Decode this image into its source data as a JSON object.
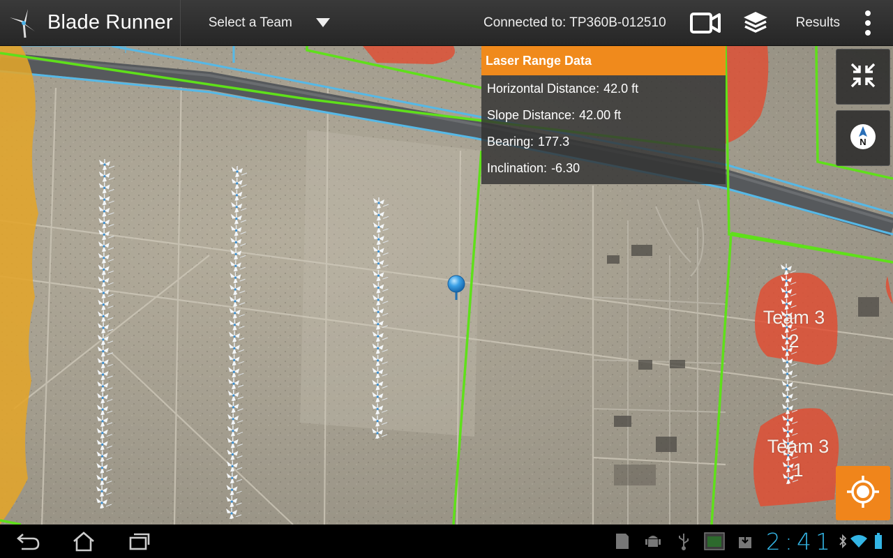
{
  "app": {
    "title": "Blade Runner",
    "team_select_label": "Select a Team",
    "connection_text": "Connected to: TP360B-012510",
    "results_label": "Results"
  },
  "icons": {
    "app": "wind-turbine-icon",
    "team_dropdown": "caret-down-icon",
    "camera": "video-camera-icon",
    "layers": "layers-icon",
    "overflow": "overflow-menu-icon",
    "collapse": "collapse-arrows-icon",
    "compass": "compass-north-icon",
    "locate": "crosshair-locate-icon",
    "marker": "map-pin-icon",
    "back": "back-icon",
    "home": "home-icon",
    "recents": "recent-apps-icon",
    "sd_card": "sd-card-icon",
    "android": "android-debug-icon",
    "usb": "usb-icon",
    "screenshot": "screenshot-icon",
    "download": "download-icon",
    "bluetooth": "bluetooth-icon",
    "wifi": "wifi-icon",
    "battery": "battery-icon"
  },
  "laser_range": {
    "title": "Laser Range Data",
    "rows": [
      {
        "label": "Horizontal Distance:",
        "value": "42.0 ft"
      },
      {
        "label": "Slope Distance:",
        "value": "42.00 ft"
      },
      {
        "label": "Bearing:",
        "value": "177.3"
      },
      {
        "label": "Inclination:",
        "value": "-6.30"
      }
    ]
  },
  "map": {
    "zones": [
      {
        "line1": "Team 3",
        "line2": "2"
      },
      {
        "line1": "Team 3",
        "line2": "1"
      }
    ]
  },
  "system": {
    "clock": "2:41"
  },
  "colors": {
    "accent": "#f08a1c",
    "boundary": "#5fe01a",
    "zone": "#e34a2e",
    "road": "#56b8e6",
    "wetland": "#e2a52a",
    "clock": "#33b5e5"
  }
}
